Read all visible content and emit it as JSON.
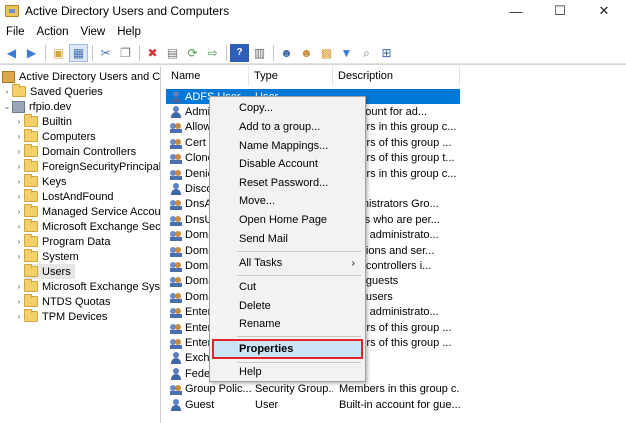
{
  "window": {
    "title": "Active Directory Users and Computers",
    "minimize_glyph": "—",
    "maximize_glyph": "☐",
    "close_glyph": "✕"
  },
  "menu": [
    "File",
    "Action",
    "View",
    "Help"
  ],
  "tree": {
    "root": "Active Directory Users and Com",
    "saved_queries": "Saved Queries",
    "domain": "rfpio.dev",
    "items": [
      "Builtin",
      "Computers",
      "Domain Controllers",
      "ForeignSecurityPrincipals",
      "Keys",
      "LostAndFound",
      "Managed Service Accou",
      "Microsoft Exchange Secu",
      "Program Data",
      "System",
      "Users",
      "Microsoft Exchange Syste",
      "NTDS Quotas",
      "TPM Devices"
    ],
    "selected_item": "Users"
  },
  "list": {
    "columns": [
      "Name",
      "Type",
      "Description"
    ],
    "rows": [
      {
        "name": "ADFS User",
        "type": "User",
        "desc": "",
        "icon": "user-icon"
      },
      {
        "name": "Admi",
        "type": "",
        "desc": "n account for ad...",
        "icon": "user-icon"
      },
      {
        "name": "Allow",
        "type": "",
        "desc": "embers in this group c...",
        "icon": "group-icon"
      },
      {
        "name": "Cert P",
        "type": "",
        "desc": "embers of this group ...",
        "icon": "group-icon"
      },
      {
        "name": "Clone",
        "type": "",
        "desc": "embers of this group t...",
        "icon": "group-icon"
      },
      {
        "name": "Denie",
        "type": "",
        "desc": "embers in this group c...",
        "icon": "group-icon"
      },
      {
        "name": "Disco",
        "type": "",
        "desc": "",
        "icon": "user-icon"
      },
      {
        "name": "DnsAc",
        "type": "",
        "desc": "administrators Gro...",
        "icon": "group-icon"
      },
      {
        "name": "DnsUp",
        "type": "",
        "desc": "clients who are per...",
        "icon": "group-icon"
      },
      {
        "name": "Doma",
        "type": "",
        "desc": "nated administrato...",
        "icon": "group-icon"
      },
      {
        "name": "Doma",
        "type": "",
        "desc": "rkstations and ser...",
        "icon": "group-icon"
      },
      {
        "name": "Doma",
        "type": "",
        "desc": "main controllers i...",
        "icon": "group-icon"
      },
      {
        "name": "Doma",
        "type": "",
        "desc": "main guests",
        "icon": "group-icon"
      },
      {
        "name": "Doma",
        "type": "",
        "desc": "main users",
        "icon": "group-icon"
      },
      {
        "name": "Enterp",
        "type": "",
        "desc": "nated administrato...",
        "icon": "group-icon"
      },
      {
        "name": "Enterp",
        "type": "",
        "desc": "embers of this group ...",
        "icon": "group-icon"
      },
      {
        "name": "Enterp",
        "type": "",
        "desc": "embers of this group ...",
        "icon": "group-icon"
      },
      {
        "name": "Excha",
        "type": "",
        "desc": "",
        "icon": "user-icon"
      },
      {
        "name": "Federated...",
        "type": "User",
        "desc": "",
        "icon": "user-icon"
      },
      {
        "name": "Group Polic...",
        "type": "Security Group...",
        "desc": "Members in this group c...",
        "icon": "group-icon"
      },
      {
        "name": "Guest",
        "type": "User",
        "desc": "Built-in account for gue...",
        "icon": "user-icon"
      }
    ]
  },
  "context_menu": {
    "items": [
      {
        "label": "Copy...",
        "id": "copy"
      },
      {
        "label": "Add to a group...",
        "id": "add-to-group"
      },
      {
        "label": "Name Mappings...",
        "id": "name-mappings"
      },
      {
        "label": "Disable Account",
        "id": "disable-account"
      },
      {
        "label": "Reset Password...",
        "id": "reset-password"
      },
      {
        "label": "Move...",
        "id": "move"
      },
      {
        "label": "Open Home Page",
        "id": "open-home-page"
      },
      {
        "label": "Send Mail",
        "id": "send-mail"
      },
      {
        "label": "All Tasks",
        "id": "all-tasks"
      },
      {
        "label": "Cut",
        "id": "cut"
      },
      {
        "label": "Delete",
        "id": "delete"
      },
      {
        "label": "Rename",
        "id": "rename"
      },
      {
        "label": "Properties",
        "id": "properties"
      },
      {
        "label": "Help",
        "id": "help"
      }
    ],
    "submenu_arrow": "›",
    "highlight_color": "#e3242b"
  },
  "colors": {
    "selection": "#0078d7",
    "hover": "#cce4f7"
  }
}
